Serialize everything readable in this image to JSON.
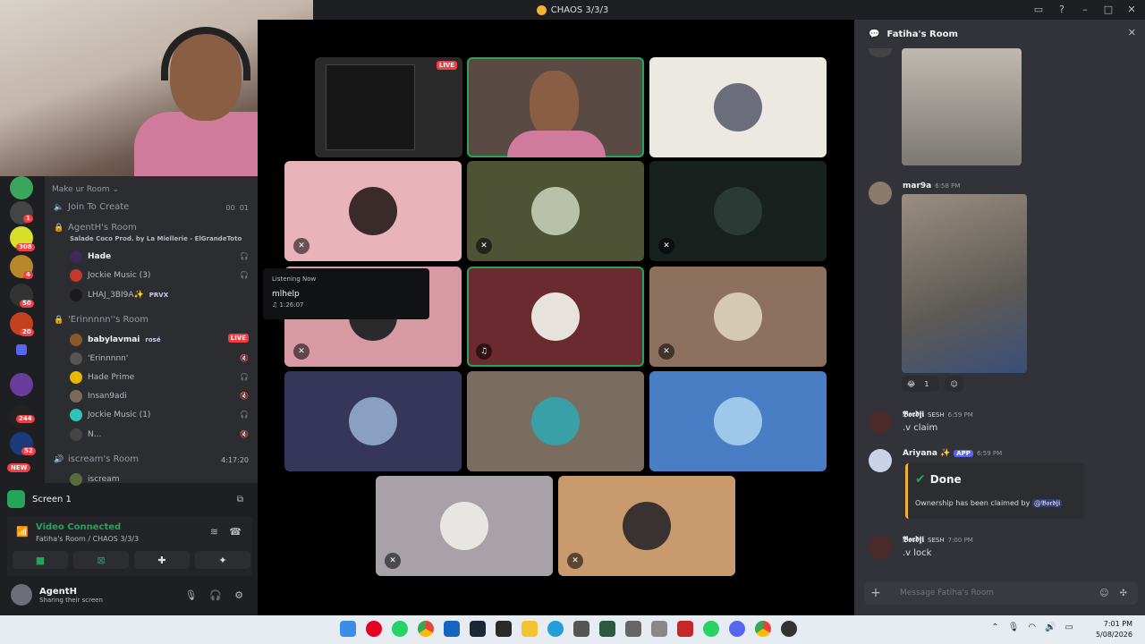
{
  "window": {
    "title": "CHAOS 3/3/3"
  },
  "webcam": {
    "live_label": "LIVE"
  },
  "server_rail": {
    "badges": [
      "1",
      "308",
      "4",
      "50",
      "20",
      "244",
      "52"
    ],
    "new_label": "NEW"
  },
  "channels": {
    "category": "Make ur Room",
    "join_to_create": {
      "name": "Join To Create",
      "count_a": "00",
      "count_b": "01"
    },
    "room1": {
      "name": "AgentH's Room",
      "now_playing": "Salade Coco Prod. by La Miellerie - ElGrandeToto",
      "users": [
        {
          "name": "Hade",
          "bold": true
        },
        {
          "name": "Jockie Music (3)"
        },
        {
          "name": "LHAJ_3BI9A✨",
          "tag": "PRVX"
        }
      ]
    },
    "room2": {
      "name": "'Erinnnnn''s Room",
      "users": [
        {
          "name": "babylavmai",
          "tag": "rosé",
          "live": "LIVE"
        },
        {
          "name": "'Erinnnnn'"
        },
        {
          "name": "Hade Prime"
        },
        {
          "name": "Insan9adi"
        },
        {
          "name": "Jockie Music (1)"
        },
        {
          "name": "N..."
        }
      ]
    },
    "room3": {
      "name": "iscream's Room",
      "timer": "4:17:20",
      "users": [
        {
          "name": "iscream"
        }
      ]
    }
  },
  "screen_panel": {
    "label": "Screen 1"
  },
  "voice_panel": {
    "status": "Video Connected",
    "subtitle": "Fatiha's Room / CHAOS 3/3/3"
  },
  "user_panel": {
    "name": "AgentH",
    "status": "Sharing their screen"
  },
  "tooltip": {
    "header": "Listening Now",
    "title": "mlhelp",
    "duration": "1:26:07"
  },
  "chat": {
    "header": "Fatiha's Room",
    "messages": [
      {
        "name": "mar9a",
        "time": "6:58 PM",
        "text": ""
      },
      {
        "name": "𝕭𝖔𝖗𝖉𝖏𝖎",
        "tag": "SESH",
        "time": "6:59 PM",
        "text": ".v claim"
      },
      {
        "name": "Ariyana ✨",
        "tag": "APP",
        "time": "6:59 PM",
        "text": ""
      },
      {
        "name": "𝕭𝖔𝖗𝖉𝖏𝖎",
        "tag": "SESH",
        "time": "7:00 PM",
        "text": ".v lock"
      }
    ],
    "reaction_count": "1",
    "embed": {
      "title": "Done",
      "desc_prefix": "Ownership has been claimed by",
      "mention": "@𝕭𝖔𝖗𝖉𝖏𝖎"
    },
    "composer_placeholder": "Message Fatiha's Room"
  },
  "taskbar": {
    "time": "7:01 PM",
    "date": "5/08/2026"
  },
  "colors": {
    "accent_green": "#23a55a",
    "live_red": "#f23f43",
    "blurple": "#5865f2"
  }
}
